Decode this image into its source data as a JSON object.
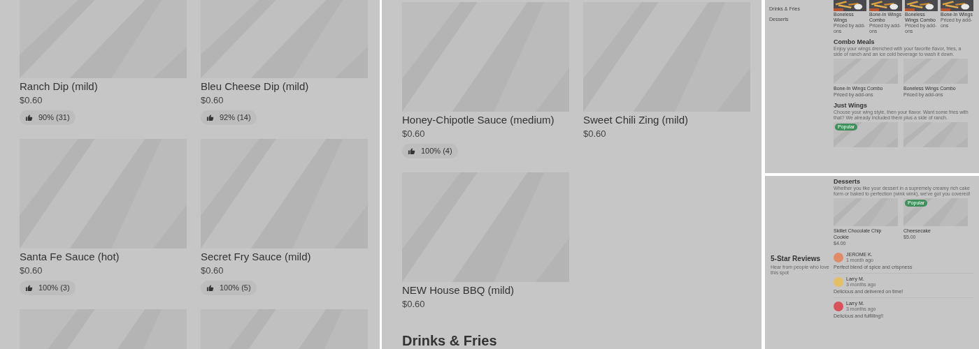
{
  "left_panel": {
    "items": [
      {
        "kind": "dish",
        "name": "Ranch Dip (mild)",
        "price": "$0.60",
        "rating": "90% (31)"
      },
      {
        "kind": "dish",
        "name": "Bleu Cheese Dip (mild)",
        "price": "$0.60",
        "rating": "92% (14)"
      },
      {
        "kind": "dish",
        "name": "Santa Fe Sauce (hot)",
        "price": "$0.60",
        "rating": "100% (3)"
      },
      {
        "kind": "dish",
        "name": "Secret Fry Sauce (mild)",
        "price": "$0.60",
        "rating": "100% (5)"
      },
      {
        "kind": "picture"
      },
      {
        "kind": "picture"
      }
    ]
  },
  "middle_panel": {
    "items": [
      {
        "kind": "dish",
        "name": "Honey-Chipotle Sauce (medium)",
        "price": "$0.60",
        "rating": "100% (4)"
      },
      {
        "kind": "dish",
        "name": "Sweet Chili Zing (mild)",
        "price": "$0.60"
      },
      {
        "kind": "dish",
        "name": "NEW House BBQ (mild)",
        "price": "$0.60"
      }
    ],
    "next_section": "Drinks & Fries"
  },
  "store_top": {
    "sidebar": [
      "Drinks & Fries",
      "Desserts"
    ],
    "featured": [
      {
        "name": "Boneless Wings",
        "note": "Priced by add-ons"
      },
      {
        "name": "Bone-In Wings Combo",
        "note": "Priced by add-ons"
      },
      {
        "name": "Boneless Wings Combo",
        "note": "Priced by add-ons"
      },
      {
        "name": "Bone-In Wings",
        "note": "Priced by add-ons"
      }
    ],
    "sections": [
      {
        "title": "Combo Meals",
        "description": "Enjoy your wings drenched with your favorite flavor, fries, a side of ranch and an ice cold beverage to wash it down.",
        "items": [
          {
            "kind": "dish",
            "name": "Bone-In Wings Combo",
            "note": "Priced by add-ons"
          },
          {
            "kind": "dish",
            "name": "Boneless Wings Combo",
            "note": "Priced by add-ons"
          }
        ]
      },
      {
        "title": "Just Wings",
        "description": "Choose your wing style, then your flavor. Want some fries with that? We already included them plus a side of ranch.",
        "items": [
          {
            "kind": "picture",
            "badge": "Popular"
          },
          {
            "kind": "picture"
          }
        ]
      }
    ]
  },
  "store_bottom": {
    "section": {
      "title": "Desserts",
      "description": "Whether you like your dessert in a supremely creamy rich cake form or baked to perfection (wink wink), we've got you covered!",
      "items": [
        {
          "kind": "dish",
          "name": "Skillet Chocolate Chip Cookie",
          "note": "$4.00"
        },
        {
          "kind": "dish",
          "name": "Cheesecake",
          "note": "$5.00",
          "badge": "Popular"
        }
      ]
    },
    "reviews": {
      "title": "5-Star Reviews",
      "subtitle": "Hear from people who love this spot",
      "items": [
        {
          "author": "JEROME K.",
          "time": "1 month ago",
          "text": "Perfect blend of spice and crispness",
          "color": "#e08a6a"
        },
        {
          "author": "Larry M.",
          "time": "3 months ago",
          "text": "Delicious and delivered on time!",
          "color": "#e3c064"
        },
        {
          "author": "Larry M.",
          "time": "3 months ago",
          "text": "Delicious and fulfilling!!",
          "color": "#d9525a"
        }
      ]
    }
  }
}
